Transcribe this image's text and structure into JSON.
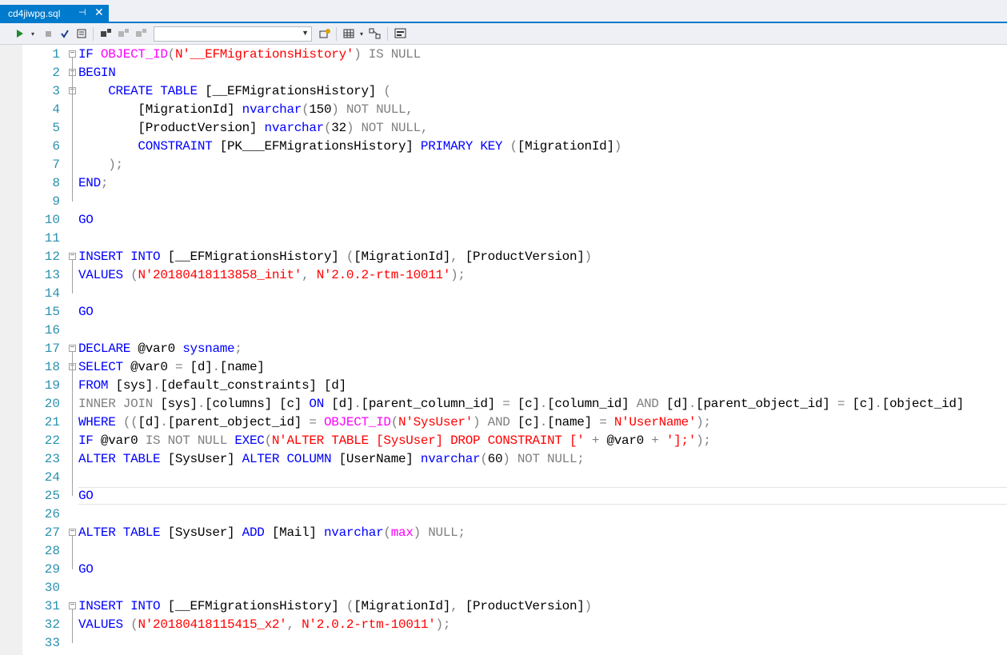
{
  "tab": {
    "title": "cd4jiwpg.sql",
    "pin": "⊣",
    "close": "✕"
  },
  "toolbar": {
    "execute": "execute-icon",
    "database_select": ""
  },
  "lines": [
    {
      "n": "1",
      "fold": "minus",
      "segs": [
        [
          "k",
          "IF "
        ],
        [
          "f",
          "OBJECT_ID"
        ],
        [
          "g",
          "("
        ],
        [
          "s",
          "N'__EFMigrationsHistory'"
        ],
        [
          "g",
          ") IS NULL"
        ]
      ]
    },
    {
      "n": "2",
      "fold": "minus",
      "segs": [
        [
          "k",
          "BEGIN"
        ]
      ]
    },
    {
      "n": "3",
      "fold": "minus",
      "segs": [
        [
          "t",
          "    "
        ],
        [
          "k",
          "CREATE TABLE "
        ],
        [
          "t",
          "[__EFMigrationsHistory] "
        ],
        [
          "g",
          "("
        ]
      ]
    },
    {
      "n": "4",
      "segs": [
        [
          "t",
          "        [MigrationId] "
        ],
        [
          "k",
          "nvarchar"
        ],
        [
          "g",
          "("
        ],
        [
          "t",
          "150"
        ],
        [
          "g",
          ") NOT NULL,"
        ]
      ]
    },
    {
      "n": "5",
      "segs": [
        [
          "t",
          "        [ProductVersion] "
        ],
        [
          "k",
          "nvarchar"
        ],
        [
          "g",
          "("
        ],
        [
          "t",
          "32"
        ],
        [
          "g",
          ") NOT NULL,"
        ]
      ]
    },
    {
      "n": "6",
      "segs": [
        [
          "t",
          "        "
        ],
        [
          "k",
          "CONSTRAINT "
        ],
        [
          "t",
          "[PK___EFMigrationsHistory] "
        ],
        [
          "k",
          "PRIMARY KEY "
        ],
        [
          "g",
          "("
        ],
        [
          "t",
          "[MigrationId]"
        ],
        [
          "g",
          ")"
        ]
      ]
    },
    {
      "n": "7",
      "segs": [
        [
          "t",
          "    "
        ],
        [
          "g",
          ");"
        ]
      ]
    },
    {
      "n": "8",
      "segs": [
        [
          "k",
          "END"
        ],
        [
          "g",
          ";"
        ]
      ]
    },
    {
      "n": "9",
      "segs": []
    },
    {
      "n": "10",
      "segs": [
        [
          "k",
          "GO"
        ]
      ]
    },
    {
      "n": "11",
      "segs": []
    },
    {
      "n": "12",
      "fold": "minus",
      "segs": [
        [
          "k",
          "INSERT INTO "
        ],
        [
          "t",
          "[__EFMigrationsHistory] "
        ],
        [
          "g",
          "("
        ],
        [
          "t",
          "[MigrationId]"
        ],
        [
          "g",
          ", "
        ],
        [
          "t",
          "[ProductVersion]"
        ],
        [
          "g",
          ")"
        ]
      ]
    },
    {
      "n": "13",
      "segs": [
        [
          "k",
          "VALUES "
        ],
        [
          "g",
          "("
        ],
        [
          "s",
          "N'20180418113858_init'"
        ],
        [
          "g",
          ", "
        ],
        [
          "s",
          "N'2.0.2-rtm-10011'"
        ],
        [
          "g",
          ");"
        ]
      ]
    },
    {
      "n": "14",
      "segs": []
    },
    {
      "n": "15",
      "segs": [
        [
          "k",
          "GO"
        ]
      ]
    },
    {
      "n": "16",
      "segs": []
    },
    {
      "n": "17",
      "fold": "minus",
      "segs": [
        [
          "k",
          "DECLARE "
        ],
        [
          "t",
          "@var0 "
        ],
        [
          "k",
          "sysname"
        ],
        [
          "g",
          ";"
        ]
      ]
    },
    {
      "n": "18",
      "fold": "minus",
      "segs": [
        [
          "k",
          "SELECT "
        ],
        [
          "t",
          "@var0 "
        ],
        [
          "g",
          "= "
        ],
        [
          "t",
          "[d]"
        ],
        [
          "g",
          "."
        ],
        [
          "t",
          "[name]"
        ]
      ]
    },
    {
      "n": "19",
      "segs": [
        [
          "k",
          "FROM "
        ],
        [
          "t",
          "[sys]"
        ],
        [
          "g",
          "."
        ],
        [
          "t",
          "[default_constraints] [d]"
        ]
      ]
    },
    {
      "n": "20",
      "segs": [
        [
          "g",
          "INNER JOIN "
        ],
        [
          "t",
          "[sys]"
        ],
        [
          "g",
          "."
        ],
        [
          "t",
          "[columns] [c] "
        ],
        [
          "k",
          "ON "
        ],
        [
          "t",
          "[d]"
        ],
        [
          "g",
          "."
        ],
        [
          "t",
          "[parent_column_id] "
        ],
        [
          "g",
          "= "
        ],
        [
          "t",
          "[c]"
        ],
        [
          "g",
          "."
        ],
        [
          "t",
          "[column_id] "
        ],
        [
          "g",
          "AND "
        ],
        [
          "t",
          "[d]"
        ],
        [
          "g",
          "."
        ],
        [
          "t",
          "[parent_object_id] "
        ],
        [
          "g",
          "= "
        ],
        [
          "t",
          "[c]"
        ],
        [
          "g",
          "."
        ],
        [
          "t",
          "[object_id]"
        ]
      ]
    },
    {
      "n": "21",
      "segs": [
        [
          "k",
          "WHERE "
        ],
        [
          "g",
          "(("
        ],
        [
          "t",
          "[d]"
        ],
        [
          "g",
          "."
        ],
        [
          "t",
          "[parent_object_id] "
        ],
        [
          "g",
          "= "
        ],
        [
          "f",
          "OBJECT_ID"
        ],
        [
          "g",
          "("
        ],
        [
          "s",
          "N'SysUser'"
        ],
        [
          "g",
          ") AND "
        ],
        [
          "t",
          "[c]"
        ],
        [
          "g",
          "."
        ],
        [
          "t",
          "[name] "
        ],
        [
          "g",
          "= "
        ],
        [
          "s",
          "N'UserName'"
        ],
        [
          "g",
          ");"
        ]
      ]
    },
    {
      "n": "22",
      "segs": [
        [
          "k",
          "IF "
        ],
        [
          "t",
          "@var0 "
        ],
        [
          "g",
          "IS NOT NULL "
        ],
        [
          "k",
          "EXEC"
        ],
        [
          "g",
          "("
        ],
        [
          "s",
          "N'ALTER TABLE [SysUser] DROP CONSTRAINT ['"
        ],
        [
          "g",
          " + "
        ],
        [
          "t",
          "@var0 "
        ],
        [
          "g",
          "+ "
        ],
        [
          "s",
          "'];'"
        ],
        [
          "g",
          ");"
        ]
      ]
    },
    {
      "n": "23",
      "segs": [
        [
          "k",
          "ALTER TABLE "
        ],
        [
          "t",
          "[SysUser] "
        ],
        [
          "k",
          "ALTER COLUMN "
        ],
        [
          "t",
          "[UserName] "
        ],
        [
          "k",
          "nvarchar"
        ],
        [
          "g",
          "("
        ],
        [
          "t",
          "60"
        ],
        [
          "g",
          ") NOT NULL;"
        ]
      ]
    },
    {
      "n": "24",
      "segs": []
    },
    {
      "n": "25",
      "segs": [
        [
          "k",
          "GO"
        ]
      ]
    },
    {
      "n": "26",
      "segs": []
    },
    {
      "n": "27",
      "fold": "minus",
      "segs": [
        [
          "k",
          "ALTER TABLE "
        ],
        [
          "t",
          "[SysUser] "
        ],
        [
          "k",
          "ADD "
        ],
        [
          "t",
          "[Mail] "
        ],
        [
          "k",
          "nvarchar"
        ],
        [
          "g",
          "("
        ],
        [
          "f",
          "max"
        ],
        [
          "g",
          ") NULL;"
        ]
      ]
    },
    {
      "n": "28",
      "segs": []
    },
    {
      "n": "29",
      "segs": [
        [
          "k",
          "GO"
        ]
      ]
    },
    {
      "n": "30",
      "segs": []
    },
    {
      "n": "31",
      "fold": "minus",
      "segs": [
        [
          "k",
          "INSERT INTO "
        ],
        [
          "t",
          "[__EFMigrationsHistory] "
        ],
        [
          "g",
          "("
        ],
        [
          "t",
          "[MigrationId]"
        ],
        [
          "g",
          ", "
        ],
        [
          "t",
          "[ProductVersion]"
        ],
        [
          "g",
          ")"
        ]
      ]
    },
    {
      "n": "32",
      "segs": [
        [
          "k",
          "VALUES "
        ],
        [
          "g",
          "("
        ],
        [
          "s",
          "N'20180418115415_x2'"
        ],
        [
          "g",
          ", "
        ],
        [
          "s",
          "N'2.0.2-rtm-10011'"
        ],
        [
          "g",
          ");"
        ]
      ]
    },
    {
      "n": "33",
      "segs": []
    }
  ]
}
